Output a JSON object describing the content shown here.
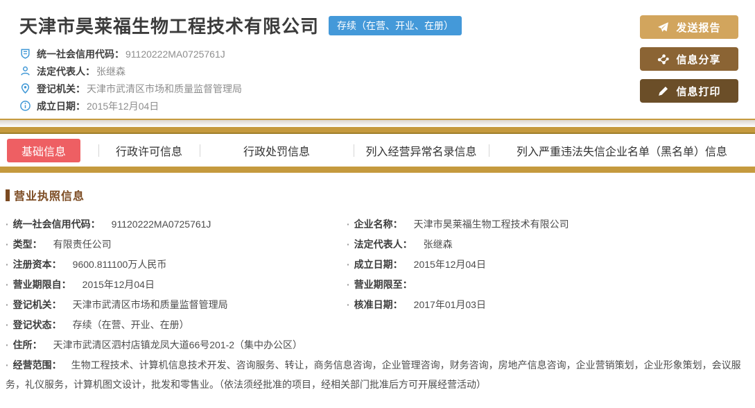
{
  "header": {
    "company_name": "天津市昊莱福生物工程技术有限公司",
    "status_badge": "存续（在营、开业、在册）",
    "info_items": [
      {
        "icon": "credit-code-icon",
        "label": "统一社会信用代码：",
        "value": "91120222MA0725761J"
      },
      {
        "icon": "person-icon",
        "label": "法定代表人：",
        "value": "张继森"
      },
      {
        "icon": "location-icon",
        "label": "登记机关：",
        "value": "天津市武清区市场和质量监督管理局"
      },
      {
        "icon": "info-circle-icon",
        "label": "成立日期：",
        "value": "2015年12月04日"
      }
    ],
    "actions": [
      {
        "icon": "paper-plane-icon",
        "label": "发送报告",
        "color": "#d2a55d"
      },
      {
        "icon": "share-nodes-icon",
        "label": "信息分享",
        "color": "#8b6434"
      },
      {
        "icon": "pencil-icon",
        "label": "信息打印",
        "color": "#6b4e28"
      }
    ]
  },
  "tabs": [
    {
      "label": "基础信息",
      "active": true
    },
    {
      "label": "行政许可信息",
      "active": false
    },
    {
      "label": "行政处罚信息",
      "active": false
    },
    {
      "label": "列入经营异常名录信息",
      "active": false
    },
    {
      "label": "列入严重违法失信企业名单（黑名单）信息",
      "active": false
    }
  ],
  "license": {
    "section_title": "营业执照信息",
    "rows": [
      {
        "label": "统一社会信用代码：",
        "value": "91120222MA0725761J"
      },
      {
        "label": "企业名称：",
        "value": "天津市昊莱福生物工程技术有限公司"
      },
      {
        "label": "类型：",
        "value": "有限责任公司"
      },
      {
        "label": "法定代表人：",
        "value": "张继森"
      },
      {
        "label": "注册资本：",
        "value": "9600.811100万人民币"
      },
      {
        "label": "成立日期：",
        "value": "2015年12月04日"
      },
      {
        "label": "营业期限自：",
        "value": "2015年12月04日"
      },
      {
        "label": "营业期限至：",
        "value": ""
      },
      {
        "label": "登记机关：",
        "value": "天津市武清区市场和质量监督管理局"
      },
      {
        "label": "核准日期：",
        "value": "2017年01月03日"
      },
      {
        "label": "登记状态：",
        "value": "存续（在营、开业、在册）"
      }
    ],
    "address": {
      "label": "住所：",
      "value": "天津市武清区泗村店镇龙凤大道66号201-2（集中办公区）"
    },
    "business_scope": {
      "label": "经营范围：",
      "value": "生物工程技术、计算机信息技术开发、咨询服务、转让，商务信息咨询，企业管理咨询，财务咨询，房地产信息咨询，企业营销策划，企业形象策划，会议服务，礼仪服务，计算机图文设计，批发和零售业。（依法须经批准的项目，经相关部门批准后方可开展经营活动）"
    }
  },
  "glyphs": {
    "bullet": "·"
  },
  "colors": {
    "gold_band": "#c59a3e",
    "gold_band_edge": "#9f7f2a",
    "tab_active_red": "#ee5f63",
    "badge_blue": "#4499d9",
    "icon_blue": "#3e97d6",
    "section_brown": "#7b4a21",
    "btn_send": "#d2a55d",
    "btn_share": "#8b6434",
    "btn_print": "#6b4e28"
  }
}
